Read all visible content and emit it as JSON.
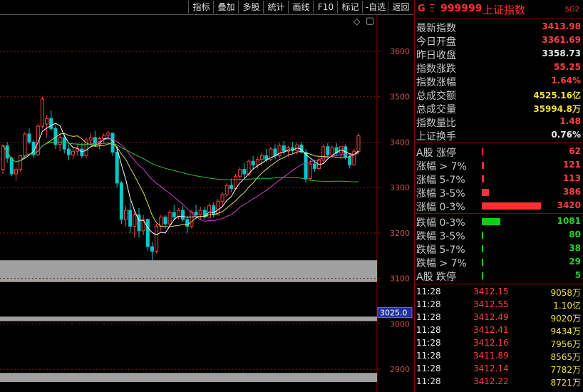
{
  "toolbar": {
    "buttons": [
      "指标",
      "叠加",
      "多股",
      "统计",
      "画线",
      "F10",
      "标记",
      "-自选",
      "返回"
    ]
  },
  "chart": {
    "y_ticks": [
      "3600",
      "3500",
      "3400",
      "3300",
      "3200",
      "3100",
      "3000",
      "2900"
    ],
    "price_marker": "3025.0",
    "controls": {
      "diamond": "◇",
      "box": "▢"
    }
  },
  "colors": {
    "up": "#ff4040",
    "down": "#00c8c8",
    "ma5": "#ffffff",
    "ma10": "#e0e060",
    "ma20": "#d040d0",
    "ma60": "#30c030",
    "marker_bg": "#2030a0"
  },
  "chart_data": {
    "type": "candlestick",
    "ylim": [
      2850,
      3680
    ],
    "y_ticks": [
      3600,
      3500,
      3400,
      3300,
      3200,
      3100,
      3000,
      2900
    ],
    "candles": [
      [
        3340,
        3395,
        3330,
        3392
      ],
      [
        3392,
        3400,
        3355,
        3365
      ],
      [
        3365,
        3368,
        3325,
        3330
      ],
      [
        3330,
        3345,
        3315,
        3340
      ],
      [
        3340,
        3372,
        3335,
        3370
      ],
      [
        3370,
        3422,
        3365,
        3418
      ],
      [
        3418,
        3430,
        3395,
        3400
      ],
      [
        3400,
        3405,
        3365,
        3372
      ],
      [
        3372,
        3440,
        3370,
        3435
      ],
      [
        3435,
        3500,
        3430,
        3495
      ],
      [
        3440,
        3460,
        3410,
        3452
      ],
      [
        3452,
        3470,
        3425,
        3430
      ],
      [
        3430,
        3438,
        3385,
        3395
      ],
      [
        3395,
        3420,
        3380,
        3410
      ],
      [
        3410,
        3418,
        3375,
        3385
      ],
      [
        3385,
        3395,
        3360,
        3372
      ],
      [
        3372,
        3388,
        3362,
        3380
      ],
      [
        3380,
        3395,
        3370,
        3385
      ],
      [
        3385,
        3398,
        3365,
        3370
      ],
      [
        3370,
        3410,
        3365,
        3405
      ],
      [
        3405,
        3420,
        3395,
        3410
      ],
      [
        3410,
        3425,
        3390,
        3395
      ],
      [
        3395,
        3412,
        3385,
        3408
      ],
      [
        3408,
        3420,
        3398,
        3415
      ],
      [
        3415,
        3425,
        3405,
        3420
      ],
      [
        3420,
        3420,
        3370,
        3378
      ],
      [
        3378,
        3385,
        3300,
        3310
      ],
      [
        3310,
        3315,
        3220,
        3230
      ],
      [
        3230,
        3260,
        3215,
        3250
      ],
      [
        3250,
        3270,
        3200,
        3215
      ],
      [
        3215,
        3248,
        3190,
        3240
      ],
      [
        3240,
        3255,
        3190,
        3205
      ],
      [
        3205,
        3240,
        3195,
        3230
      ],
      [
        3230,
        3232,
        3160,
        3170
      ],
      [
        3170,
        3180,
        3140,
        3160
      ],
      [
        3160,
        3220,
        3155,
        3215
      ],
      [
        3215,
        3240,
        3205,
        3235
      ],
      [
        3235,
        3240,
        3210,
        3220
      ],
      [
        3220,
        3250,
        3215,
        3245
      ],
      [
        3245,
        3262,
        3228,
        3235
      ],
      [
        3235,
        3255,
        3230,
        3250
      ],
      [
        3250,
        3260,
        3225,
        3230
      ],
      [
        3230,
        3238,
        3200,
        3215
      ],
      [
        3215,
        3252,
        3210,
        3246
      ],
      [
        3246,
        3262,
        3230,
        3240
      ],
      [
        3240,
        3258,
        3228,
        3250
      ],
      [
        3250,
        3258,
        3230,
        3235
      ],
      [
        3235,
        3265,
        3232,
        3260
      ],
      [
        3260,
        3268,
        3235,
        3240
      ],
      [
        3240,
        3275,
        3238,
        3270
      ],
      [
        3270,
        3290,
        3260,
        3285
      ],
      [
        3285,
        3310,
        3280,
        3305
      ],
      [
        3305,
        3320,
        3290,
        3298
      ],
      [
        3298,
        3330,
        3295,
        3325
      ],
      [
        3325,
        3345,
        3315,
        3340
      ],
      [
        3340,
        3355,
        3320,
        3330
      ],
      [
        3330,
        3362,
        3325,
        3358
      ],
      [
        3358,
        3370,
        3340,
        3350
      ],
      [
        3350,
        3368,
        3342,
        3362
      ],
      [
        3362,
        3378,
        3348,
        3370
      ],
      [
        3370,
        3385,
        3355,
        3362
      ],
      [
        3362,
        3390,
        3358,
        3385
      ],
      [
        3385,
        3395,
        3362,
        3370
      ],
      [
        3370,
        3398,
        3365,
        3392
      ],
      [
        3392,
        3402,
        3372,
        3380
      ],
      [
        3380,
        3392,
        3368,
        3388
      ],
      [
        3388,
        3400,
        3375,
        3382
      ],
      [
        3382,
        3398,
        3372,
        3394
      ],
      [
        3394,
        3400,
        3375,
        3378
      ],
      [
        3378,
        3385,
        3310,
        3320
      ],
      [
        3320,
        3360,
        3315,
        3352
      ],
      [
        3352,
        3362,
        3335,
        3342
      ],
      [
        3342,
        3368,
        3338,
        3360
      ],
      [
        3360,
        3395,
        3355,
        3390
      ],
      [
        3390,
        3398,
        3365,
        3372
      ],
      [
        3372,
        3392,
        3368,
        3388
      ],
      [
        3388,
        3398,
        3370,
        3376
      ],
      [
        3376,
        3392,
        3362,
        3390
      ],
      [
        3390,
        3395,
        3362,
        3368
      ],
      [
        3368,
        3372,
        3342,
        3350
      ],
      [
        3350,
        3385,
        3348,
        3380
      ],
      [
        3380,
        3420,
        3375,
        3414
      ]
    ]
  },
  "quote": {
    "g": "G",
    "eq": "Ξ",
    "code": "999999",
    "name": "上证指数",
    "tag": "$G2",
    "rows": [
      {
        "label": "最新指数",
        "value": "3413.98",
        "color": "red"
      },
      {
        "label": "今日开盘",
        "value": "3361.69",
        "color": "red"
      },
      {
        "label": "昨日收盘",
        "value": "3358.73",
        "color": "white"
      },
      {
        "label": "指数涨跌",
        "value": "55.25",
        "color": "red"
      },
      {
        "label": "指数涨幅",
        "value": "1.64%",
        "color": "red"
      },
      {
        "label": "总成交额",
        "value": "4525.16亿",
        "color": "yellow"
      },
      {
        "label": "总成交量",
        "value": "35994.8万",
        "color": "yellow"
      },
      {
        "label": "指数量比",
        "value": "1.48",
        "color": "red"
      },
      {
        "label": "上证换手",
        "value": "0.76%",
        "color": "white"
      }
    ],
    "breadth": [
      {
        "label": "A股 涨停",
        "value": "62",
        "color": "red",
        "frac": 0.0
      },
      {
        "label": "涨幅 > 7%",
        "value": "121",
        "color": "red",
        "frac": 0.01
      },
      {
        "label": "涨幅 5-7%",
        "value": "113",
        "color": "red",
        "frac": 0.01
      },
      {
        "label": "涨幅 3-5%",
        "value": "386",
        "color": "red",
        "frac": 0.04
      },
      {
        "label": "涨幅 0-3%",
        "value": "3420",
        "color": "red",
        "frac": 0.32
      },
      {
        "label": "跌幅 0-3%",
        "value": "1081",
        "color": "green",
        "frac": 0.1
      },
      {
        "label": "跌幅 3-5%",
        "value": "80",
        "color": "green",
        "frac": 0.0
      },
      {
        "label": "跌幅 5-7%",
        "value": "38",
        "color": "green",
        "frac": 0.0
      },
      {
        "label": "跌幅 > 7%",
        "value": "29",
        "color": "green",
        "frac": 0.0
      },
      {
        "label": "A股 跌停",
        "value": "5",
        "color": "green",
        "frac": 0.0
      }
    ],
    "ticks": [
      {
        "time": "11:28",
        "price": "3412.15",
        "vol": "9058万"
      },
      {
        "time": "11:28",
        "price": "3412.55",
        "vol": "1.10亿"
      },
      {
        "time": "11:28",
        "price": "3412.49",
        "vol": "9020万"
      },
      {
        "time": "11:28",
        "price": "3412.41",
        "vol": "9434万"
      },
      {
        "time": "11:28",
        "price": "3412.16",
        "vol": "7956万"
      },
      {
        "time": "11:28",
        "price": "3411.89",
        "vol": "8565万"
      },
      {
        "time": "11:28",
        "price": "3412.14",
        "vol": "7782万"
      },
      {
        "time": "11:28",
        "price": "3412.22",
        "vol": "8721万"
      }
    ]
  }
}
